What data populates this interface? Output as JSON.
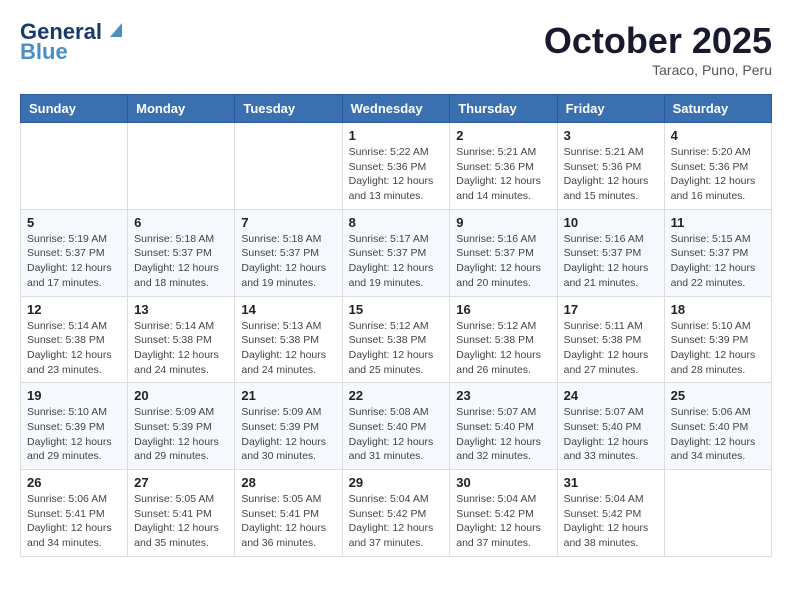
{
  "header": {
    "logo_line1": "General",
    "logo_line2": "Blue",
    "month": "October 2025",
    "location": "Taraco, Puno, Peru"
  },
  "weekdays": [
    "Sunday",
    "Monday",
    "Tuesday",
    "Wednesday",
    "Thursday",
    "Friday",
    "Saturday"
  ],
  "weeks": [
    [
      {
        "day": "",
        "info": ""
      },
      {
        "day": "",
        "info": ""
      },
      {
        "day": "",
        "info": ""
      },
      {
        "day": "1",
        "info": "Sunrise: 5:22 AM\nSunset: 5:36 PM\nDaylight: 12 hours\nand 13 minutes."
      },
      {
        "day": "2",
        "info": "Sunrise: 5:21 AM\nSunset: 5:36 PM\nDaylight: 12 hours\nand 14 minutes."
      },
      {
        "day": "3",
        "info": "Sunrise: 5:21 AM\nSunset: 5:36 PM\nDaylight: 12 hours\nand 15 minutes."
      },
      {
        "day": "4",
        "info": "Sunrise: 5:20 AM\nSunset: 5:36 PM\nDaylight: 12 hours\nand 16 minutes."
      }
    ],
    [
      {
        "day": "5",
        "info": "Sunrise: 5:19 AM\nSunset: 5:37 PM\nDaylight: 12 hours\nand 17 minutes."
      },
      {
        "day": "6",
        "info": "Sunrise: 5:18 AM\nSunset: 5:37 PM\nDaylight: 12 hours\nand 18 minutes."
      },
      {
        "day": "7",
        "info": "Sunrise: 5:18 AM\nSunset: 5:37 PM\nDaylight: 12 hours\nand 19 minutes."
      },
      {
        "day": "8",
        "info": "Sunrise: 5:17 AM\nSunset: 5:37 PM\nDaylight: 12 hours\nand 19 minutes."
      },
      {
        "day": "9",
        "info": "Sunrise: 5:16 AM\nSunset: 5:37 PM\nDaylight: 12 hours\nand 20 minutes."
      },
      {
        "day": "10",
        "info": "Sunrise: 5:16 AM\nSunset: 5:37 PM\nDaylight: 12 hours\nand 21 minutes."
      },
      {
        "day": "11",
        "info": "Sunrise: 5:15 AM\nSunset: 5:37 PM\nDaylight: 12 hours\nand 22 minutes."
      }
    ],
    [
      {
        "day": "12",
        "info": "Sunrise: 5:14 AM\nSunset: 5:38 PM\nDaylight: 12 hours\nand 23 minutes."
      },
      {
        "day": "13",
        "info": "Sunrise: 5:14 AM\nSunset: 5:38 PM\nDaylight: 12 hours\nand 24 minutes."
      },
      {
        "day": "14",
        "info": "Sunrise: 5:13 AM\nSunset: 5:38 PM\nDaylight: 12 hours\nand 24 minutes."
      },
      {
        "day": "15",
        "info": "Sunrise: 5:12 AM\nSunset: 5:38 PM\nDaylight: 12 hours\nand 25 minutes."
      },
      {
        "day": "16",
        "info": "Sunrise: 5:12 AM\nSunset: 5:38 PM\nDaylight: 12 hours\nand 26 minutes."
      },
      {
        "day": "17",
        "info": "Sunrise: 5:11 AM\nSunset: 5:38 PM\nDaylight: 12 hours\nand 27 minutes."
      },
      {
        "day": "18",
        "info": "Sunrise: 5:10 AM\nSunset: 5:39 PM\nDaylight: 12 hours\nand 28 minutes."
      }
    ],
    [
      {
        "day": "19",
        "info": "Sunrise: 5:10 AM\nSunset: 5:39 PM\nDaylight: 12 hours\nand 29 minutes."
      },
      {
        "day": "20",
        "info": "Sunrise: 5:09 AM\nSunset: 5:39 PM\nDaylight: 12 hours\nand 29 minutes."
      },
      {
        "day": "21",
        "info": "Sunrise: 5:09 AM\nSunset: 5:39 PM\nDaylight: 12 hours\nand 30 minutes."
      },
      {
        "day": "22",
        "info": "Sunrise: 5:08 AM\nSunset: 5:40 PM\nDaylight: 12 hours\nand 31 minutes."
      },
      {
        "day": "23",
        "info": "Sunrise: 5:07 AM\nSunset: 5:40 PM\nDaylight: 12 hours\nand 32 minutes."
      },
      {
        "day": "24",
        "info": "Sunrise: 5:07 AM\nSunset: 5:40 PM\nDaylight: 12 hours\nand 33 minutes."
      },
      {
        "day": "25",
        "info": "Sunrise: 5:06 AM\nSunset: 5:40 PM\nDaylight: 12 hours\nand 34 minutes."
      }
    ],
    [
      {
        "day": "26",
        "info": "Sunrise: 5:06 AM\nSunset: 5:41 PM\nDaylight: 12 hours\nand 34 minutes."
      },
      {
        "day": "27",
        "info": "Sunrise: 5:05 AM\nSunset: 5:41 PM\nDaylight: 12 hours\nand 35 minutes."
      },
      {
        "day": "28",
        "info": "Sunrise: 5:05 AM\nSunset: 5:41 PM\nDaylight: 12 hours\nand 36 minutes."
      },
      {
        "day": "29",
        "info": "Sunrise: 5:04 AM\nSunset: 5:42 PM\nDaylight: 12 hours\nand 37 minutes."
      },
      {
        "day": "30",
        "info": "Sunrise: 5:04 AM\nSunset: 5:42 PM\nDaylight: 12 hours\nand 37 minutes."
      },
      {
        "day": "31",
        "info": "Sunrise: 5:04 AM\nSunset: 5:42 PM\nDaylight: 12 hours\nand 38 minutes."
      },
      {
        "day": "",
        "info": ""
      }
    ]
  ]
}
